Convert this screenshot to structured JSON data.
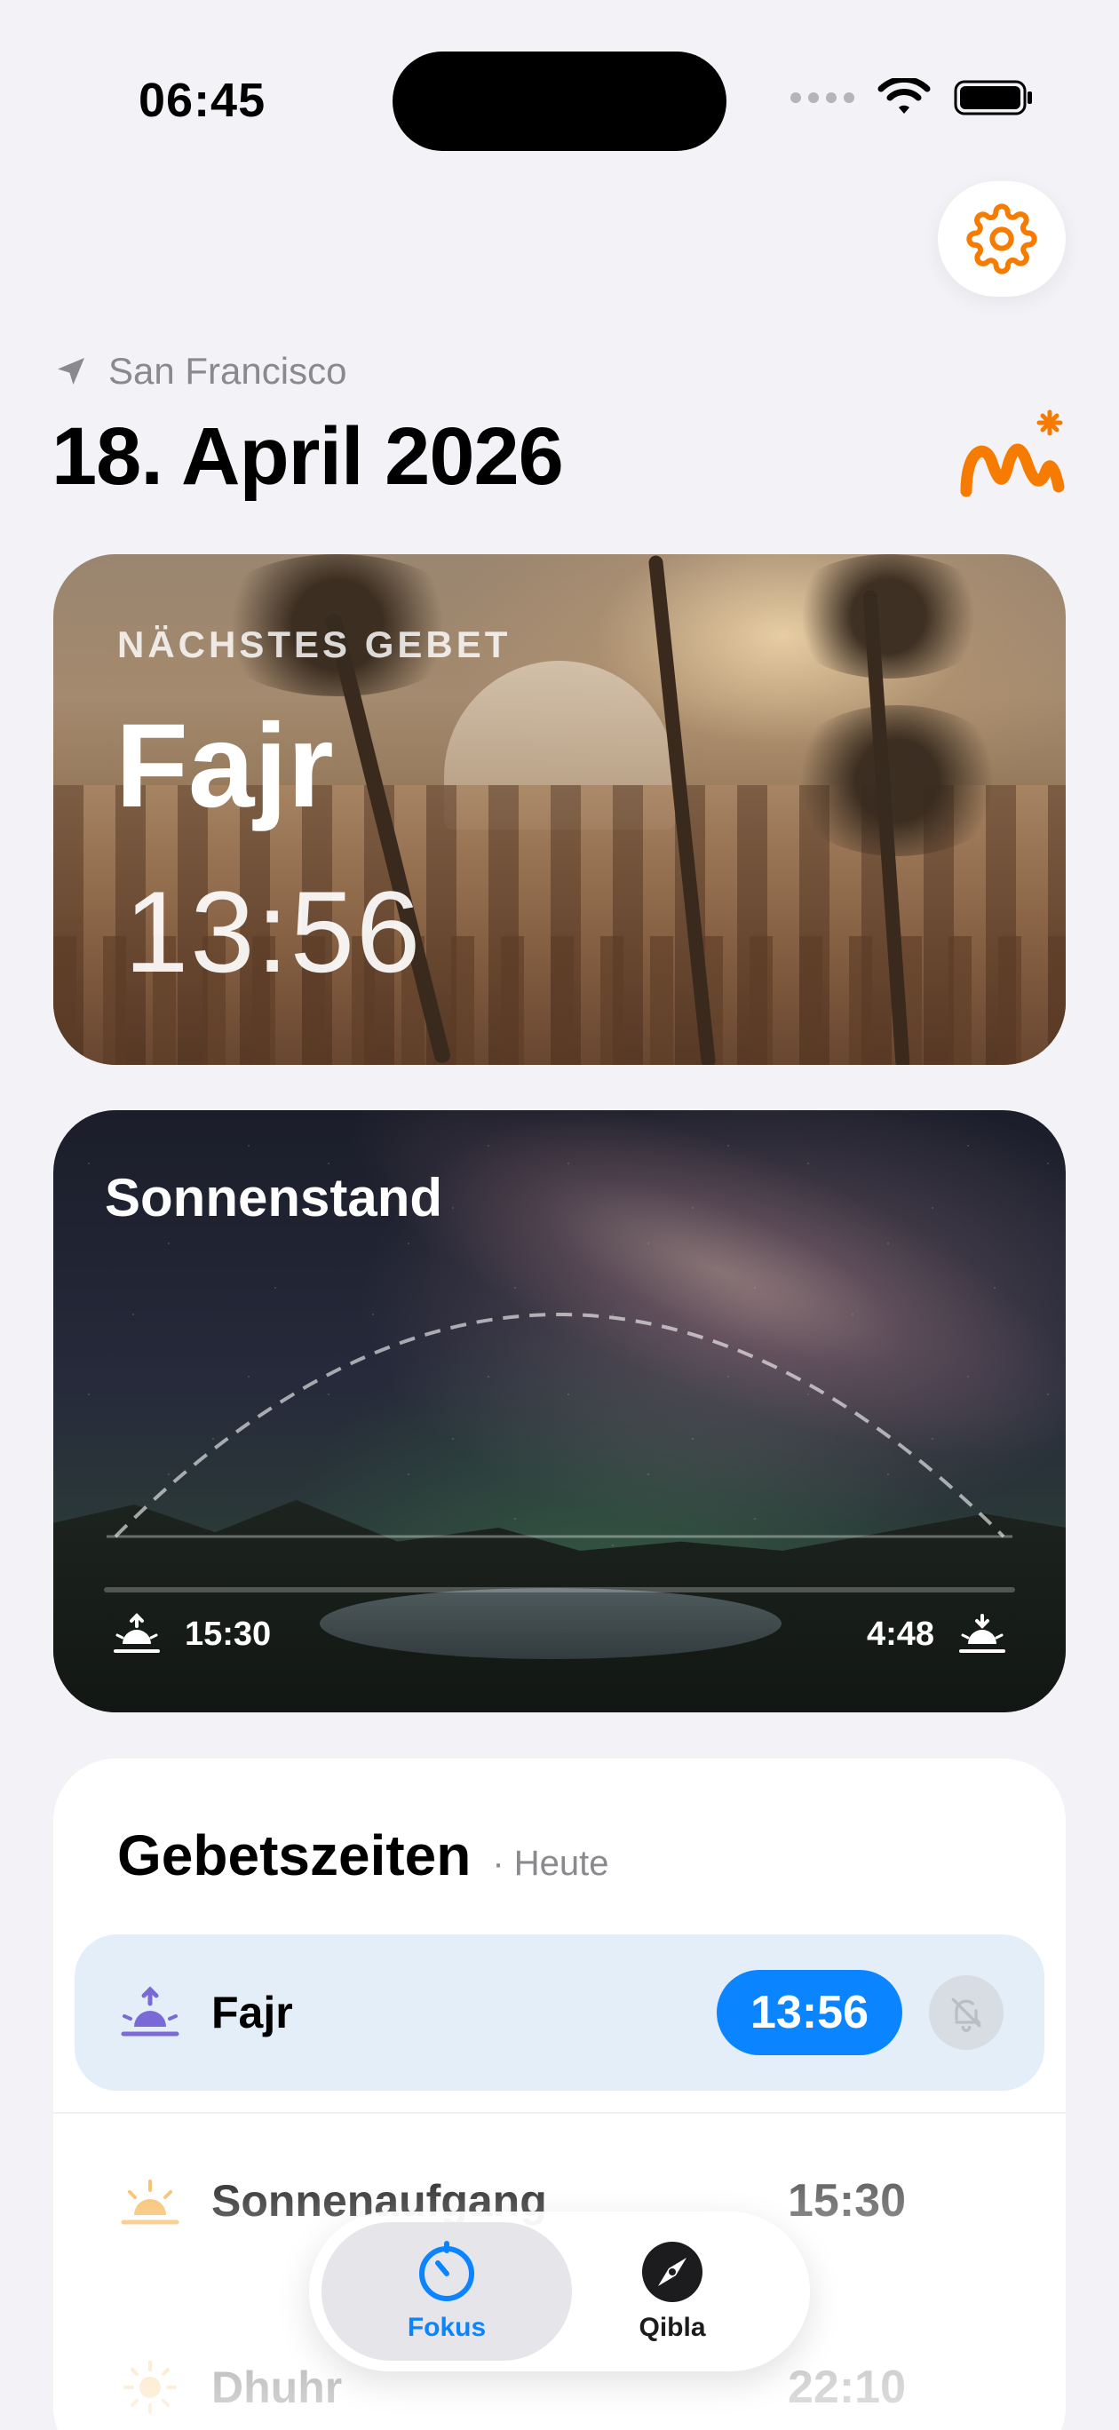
{
  "status_bar": {
    "time": "06:45"
  },
  "header": {
    "location": "San Francisco",
    "date": "18. April 2026"
  },
  "next_prayer": {
    "label": "NÄCHSTES GEBET",
    "name": "Fajr",
    "time": "13:56"
  },
  "sun_position": {
    "title": "Sonnenstand",
    "sunrise": "15:30",
    "sunset": "4:48"
  },
  "prayer_times": {
    "title": "Gebetszeiten",
    "subtitle": "· Heute",
    "rows": [
      {
        "name": "Fajr",
        "time": "13:56",
        "active": true,
        "icon": "fajr-icon"
      },
      {
        "name": "Sonnenaufgang",
        "time": "15:30",
        "active": false,
        "icon": "sunrise-icon"
      },
      {
        "name": "Dhuhr",
        "time": "22:10",
        "active": false,
        "icon": "sun-icon"
      }
    ]
  },
  "tabbar": {
    "tabs": [
      {
        "label": "Fokus",
        "icon": "timer-icon",
        "selected": true
      },
      {
        "label": "Qibla",
        "icon": "compass-icon",
        "selected": false
      }
    ]
  },
  "colors": {
    "accent": "#0a84ff",
    "settings_icon": "#f57c00",
    "brand": "#f57c00",
    "background": "#f2f2f7"
  }
}
